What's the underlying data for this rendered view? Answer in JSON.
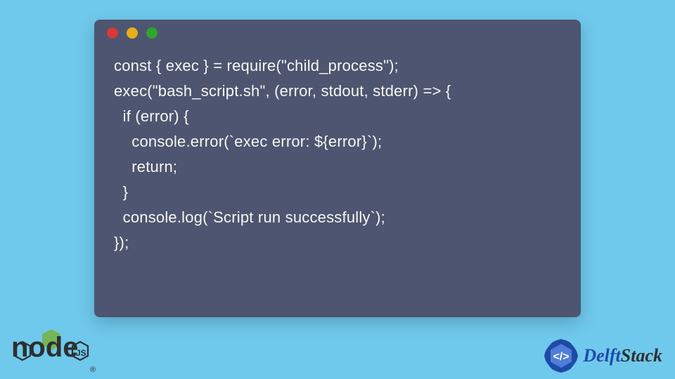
{
  "code": {
    "lines": [
      "const { exec } = require(\"child_process\");",
      "",
      "exec(\"bash_script.sh\", (error, stdout, stderr) => {",
      "  if (error) {",
      "    console.error(`exec error: ${error}`);",
      "    return;",
      "  }",
      "  console.log(`Script run successfully`);",
      "});"
    ]
  },
  "brand": {
    "node_word": "node",
    "node_reg": "®",
    "delft_blue": "Delft",
    "delft_black": "Stack"
  }
}
